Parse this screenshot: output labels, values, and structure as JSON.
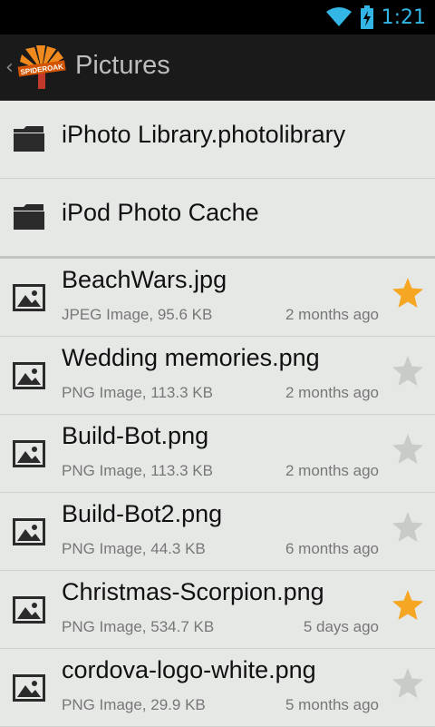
{
  "status_bar": {
    "time": "1:21",
    "wifi_icon": "wifi-icon",
    "battery_icon": "battery-charging-icon"
  },
  "action_bar": {
    "title": "Pictures",
    "logo_label": "SPIDEROAK",
    "back_icon": "chevron-left-icon"
  },
  "colors": {
    "accent": "#33b5e5",
    "star_active": "#f5a623",
    "star_inactive": "#c9cbc9"
  },
  "folders": [
    {
      "name": "iPhoto Library.photolibrary",
      "icon": "folder-icon"
    },
    {
      "name": "iPod Photo Cache",
      "icon": "folder-icon"
    }
  ],
  "files": [
    {
      "name": "BeachWars.jpg",
      "meta": "JPEG Image, 95.6 KB",
      "date": "2 months ago",
      "starred": true
    },
    {
      "name": "Wedding memories.png",
      "meta": "PNG Image, 113.3 KB",
      "date": "2 months ago",
      "starred": false
    },
    {
      "name": "Build-Bot.png",
      "meta": "PNG Image, 113.3 KB",
      "date": "2 months ago",
      "starred": false
    },
    {
      "name": "Build-Bot2.png",
      "meta": "PNG Image, 44.3 KB",
      "date": "6 months ago",
      "starred": false
    },
    {
      "name": "Christmas-Scorpion.png",
      "meta": "PNG Image, 534.7 KB",
      "date": "5 days ago",
      "starred": true
    },
    {
      "name": "cordova-logo-white.png",
      "meta": "PNG Image, 29.9 KB",
      "date": "5 months ago",
      "starred": false
    }
  ]
}
